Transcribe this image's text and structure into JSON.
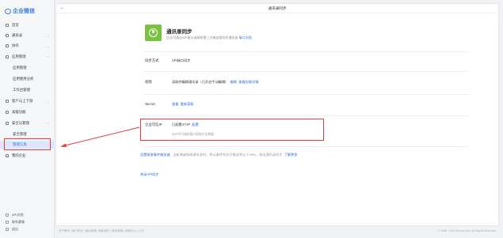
{
  "brand": {
    "name": "企业微信"
  },
  "sidebar": {
    "items": [
      {
        "label": "首页"
      },
      {
        "label": "通讯录"
      },
      {
        "label": "协作"
      },
      {
        "label": "应用管理"
      },
      {
        "label": "应用管理"
      },
      {
        "label": "应用使用分析"
      },
      {
        "label": "工作台管理"
      },
      {
        "label": "客户与上下游"
      },
      {
        "label": "高级功能"
      },
      {
        "label": "安全与管理"
      },
      {
        "label": "安全管理"
      },
      {
        "label": "管理工具"
      },
      {
        "label": "我的企业"
      }
    ],
    "footer": [
      {
        "label": "API文档"
      },
      {
        "label": "联系客服"
      },
      {
        "label": "退出"
      }
    ]
  },
  "header": {
    "title": "通讯录同步"
  },
  "app": {
    "title": "通讯录同步",
    "desc": "企业可通过API接口或授权第三方服务商同步通讯录",
    "doc_link": "接口文档"
  },
  "rows": {
    "sync_mode": {
      "label": "同步方式",
      "value": "API接口同步"
    },
    "permission": {
      "label": "权限",
      "value": "读取并编辑通讯录（已开启手动编辑）",
      "edit": "编辑",
      "detail": "查看权限详情"
    },
    "secret": {
      "label": "Secret",
      "view": "查看",
      "reget": "重新获取"
    },
    "trusted_ip": {
      "label": "企业可信IP",
      "value": "已配置4个IP",
      "config": "配置",
      "sub": "仅IP中可调用接口获取企业数据"
    },
    "callback": {
      "link": "设置接收事件服务器",
      "desc": "当新增或修改通讯录时，将以事件的形式推送到以下URL。保证通讯录同步",
      "more": "了解更多"
    },
    "close": {
      "link": "关闭API同步"
    }
  },
  "footer": {
    "links": "关于腾讯 | 用户协议 | 隐私政策 | 隐私保护 | 服务条款 | 帮助中心 | 中文",
    "copyright": "© 1998 - 2023 Tencent Inc. All Rights Reserved"
  },
  "colors": {
    "accent": "#2a6ce0",
    "highlight": "#e23b3b",
    "app_icon": "#7cc242"
  }
}
